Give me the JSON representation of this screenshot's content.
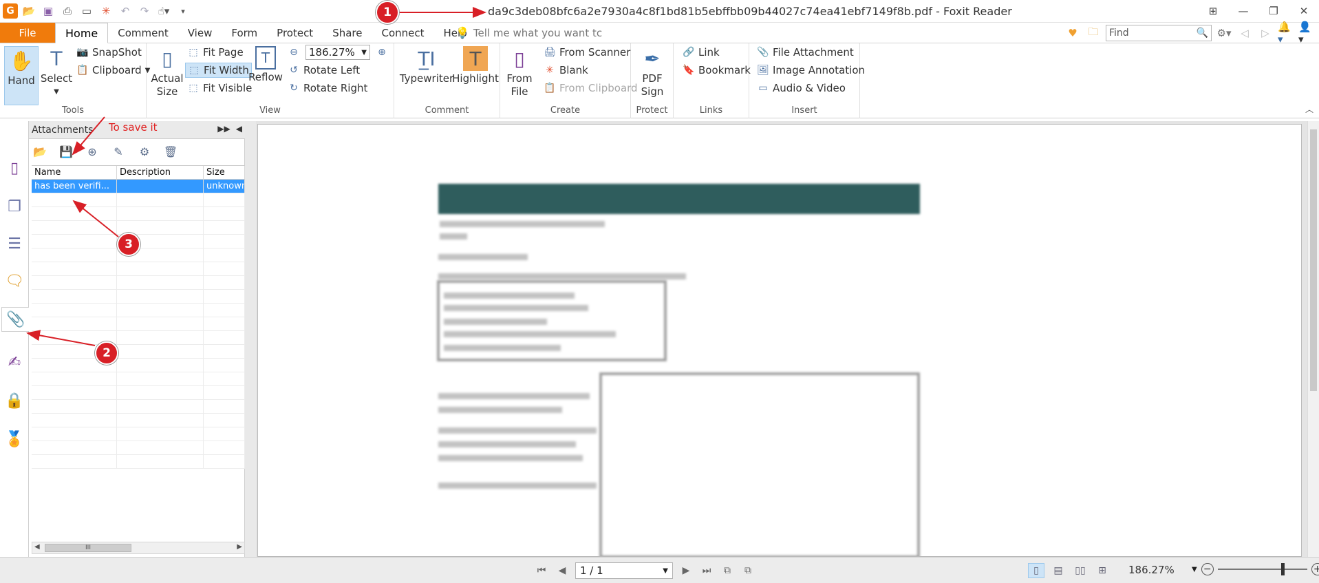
{
  "window": {
    "title": "da9c3deb08bfc6a2e7930a4c8f1bd81b5ebffbb09b44027c74ea41ebf7149f8b.pdf - Foxit Reader"
  },
  "menu": {
    "file": "File",
    "tabs": [
      "Home",
      "Comment",
      "View",
      "Form",
      "Protect",
      "Share",
      "Connect",
      "Help"
    ],
    "active_tab": "Home",
    "tell_me_placeholder": "Tell me what you want tc",
    "find_placeholder": "Find"
  },
  "ribbon": {
    "tools": {
      "label": "Tools",
      "hand": "Hand",
      "select": "Select",
      "snapshot": "SnapShot",
      "clipboard": "Clipboard"
    },
    "view": {
      "label": "View",
      "actual_size": "Actual Size",
      "actual_line1": "Actual",
      "actual_line2": "Size",
      "fit_page": "Fit Page",
      "fit_width": "Fit Width",
      "fit_visible": "Fit Visible",
      "reflow": "Reflow",
      "zoom_value": "186.27%",
      "rotate_left": "Rotate Left",
      "rotate_right": "Rotate Right"
    },
    "comment": {
      "label": "Comment",
      "typewriter": "Typewriter",
      "highlight": "Highlight"
    },
    "create": {
      "label": "Create",
      "from_file_line1": "From",
      "from_file_line2": "File",
      "from_scanner": "From Scanner",
      "blank": "Blank",
      "from_clipboard": "From Clipboard"
    },
    "protect": {
      "label": "Protect",
      "pdf_sign_line1": "PDF",
      "pdf_sign_line2": "Sign"
    },
    "links": {
      "label": "Links",
      "link": "Link",
      "bookmark": "Bookmark"
    },
    "insert": {
      "label": "Insert",
      "file_attachment": "File Attachment",
      "image_annotation": "Image Annotation",
      "audio_video": "Audio & Video"
    }
  },
  "attachments_panel": {
    "title": "Attachments",
    "columns": [
      "Name",
      "Description",
      "Size"
    ],
    "rows": [
      {
        "name": "has been verifi...",
        "description": "",
        "size": "unknown"
      }
    ]
  },
  "statusbar": {
    "page": "1 / 1",
    "zoom": "186.27%"
  },
  "annotations": {
    "badges": [
      "1",
      "2",
      "3"
    ],
    "save_note": "To save it"
  },
  "colors": {
    "accent": "#f07b0c",
    "selection": "#3399ff",
    "annotation_red": "#d81f26"
  }
}
